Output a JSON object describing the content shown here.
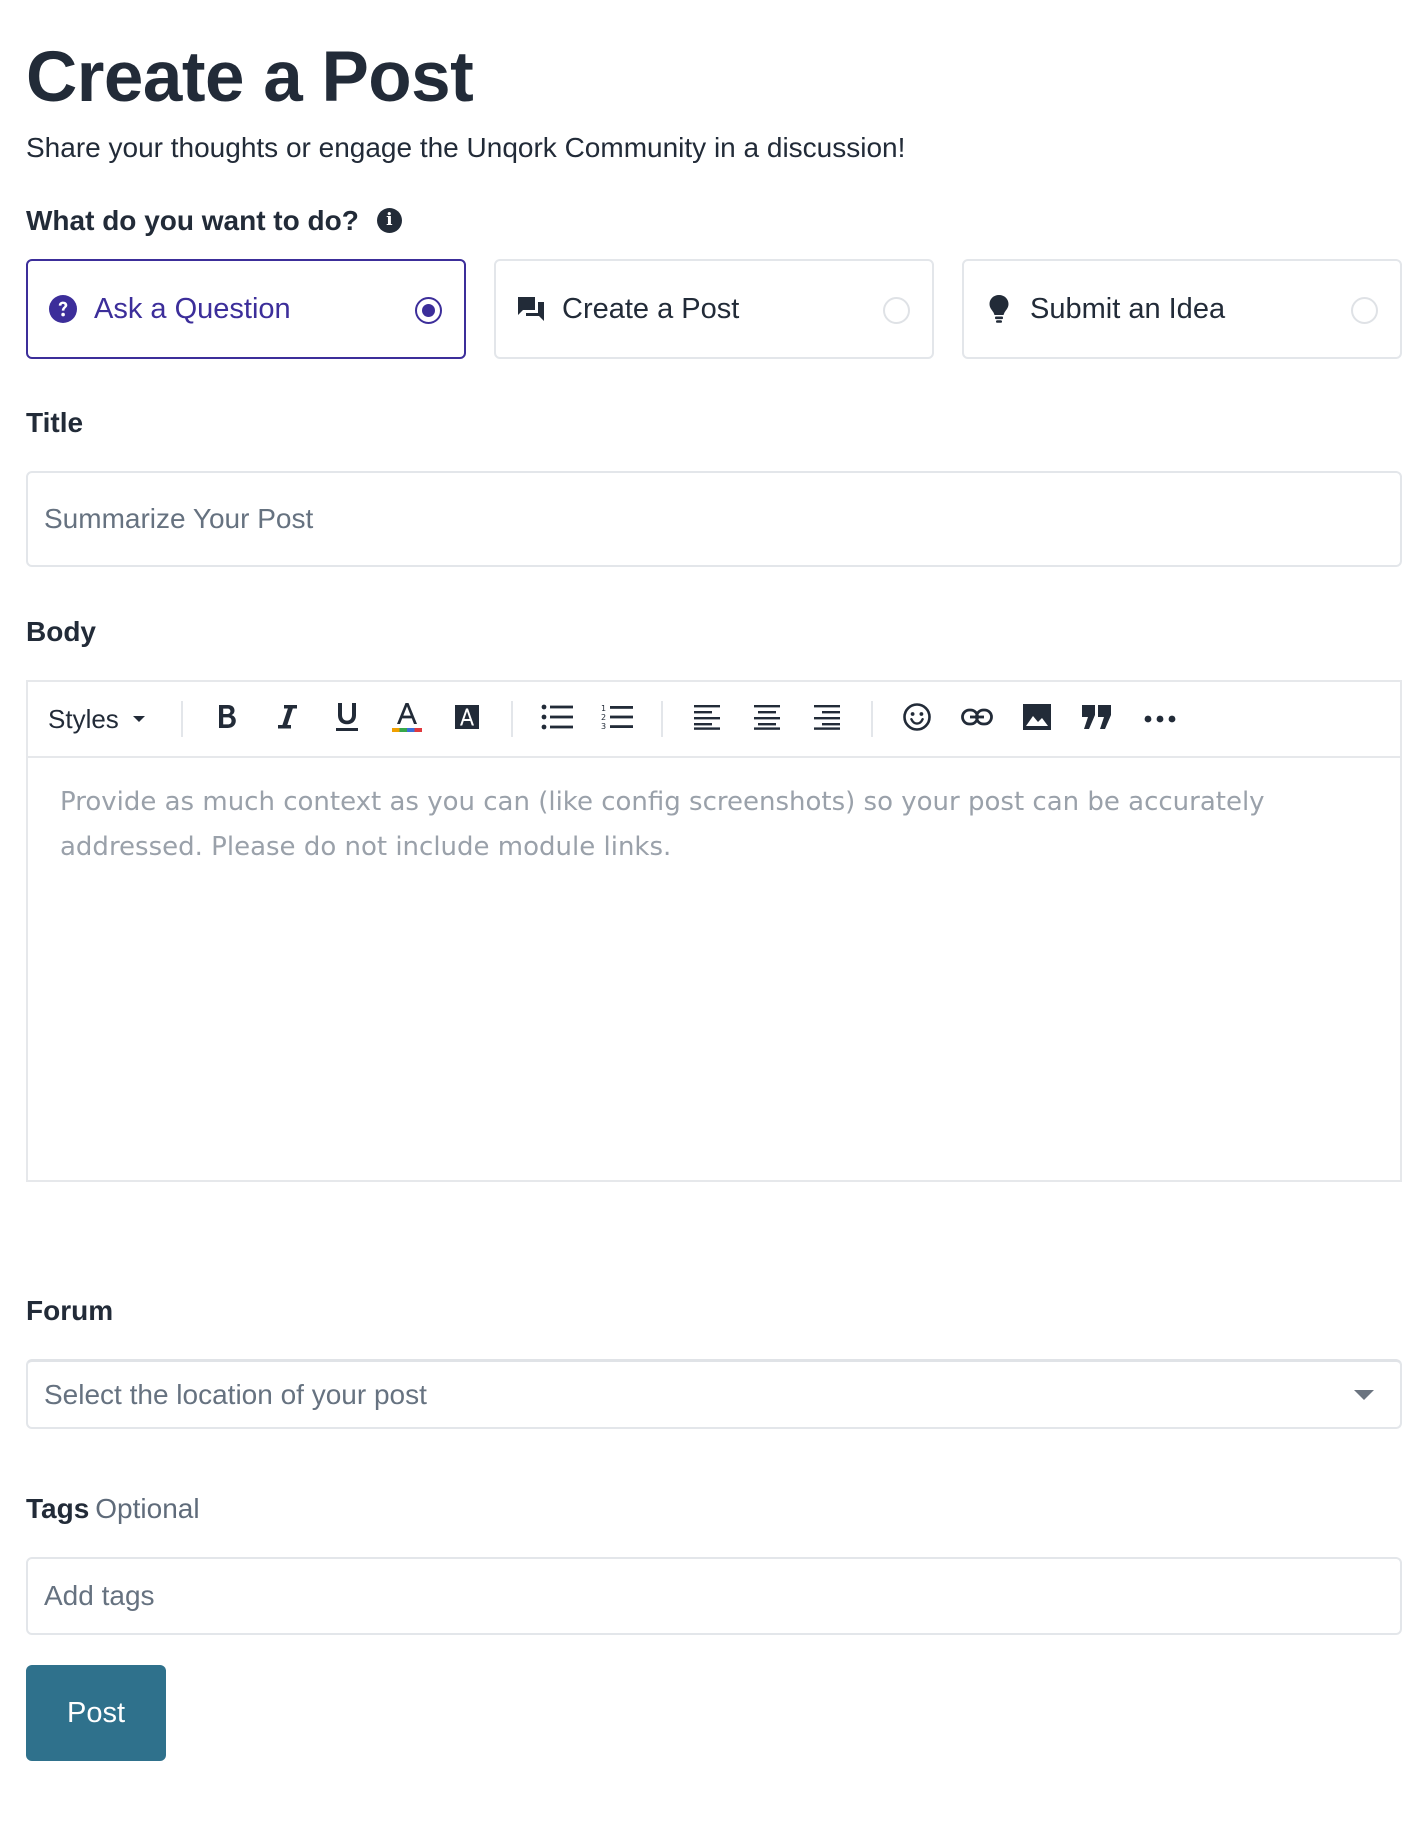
{
  "header": {
    "title": "Create a Post",
    "subtitle": "Share your thoughts or engage the Unqork Community in a discussion!"
  },
  "post_type": {
    "label": "What do you want to do?",
    "info_icon": "info-icon",
    "options": [
      {
        "label": "Ask a Question",
        "icon": "question-circle-icon",
        "selected": true
      },
      {
        "label": "Create a Post",
        "icon": "chat-bubbles-icon",
        "selected": false
      },
      {
        "label": "Submit an Idea",
        "icon": "lightbulb-icon",
        "selected": false
      }
    ]
  },
  "title_field": {
    "label": "Title",
    "placeholder": "Summarize Your Post",
    "value": ""
  },
  "body_field": {
    "label": "Body",
    "toolbar": {
      "styles_label": "Styles",
      "buttons": [
        "bold",
        "italic",
        "underline",
        "text-color",
        "highlight",
        "bulleted-list",
        "numbered-list",
        "align-left",
        "align-center",
        "align-right",
        "emoji",
        "link",
        "image",
        "blockquote",
        "more"
      ]
    },
    "placeholder": "Provide as much context as you can (like config screenshots) so your post can be accurately addressed. Please do not include module links."
  },
  "forum_field": {
    "label": "Forum",
    "placeholder": "Select the location of your post"
  },
  "tags_field": {
    "label": "Tags",
    "optional_label": "Optional",
    "placeholder": "Add tags"
  },
  "submit": {
    "label": "Post"
  },
  "colors": {
    "accent": "#3c2e9a",
    "button": "#2f718c",
    "text": "#222b38",
    "border": "#e3e6ea"
  }
}
